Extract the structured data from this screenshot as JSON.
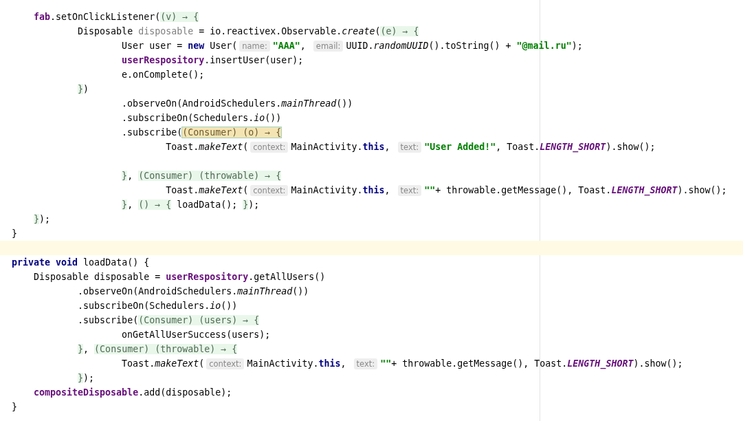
{
  "editor": {
    "lines": [
      {
        "current": false,
        "tokens": [
          {
            "kind": "field",
            "text": "    fab"
          },
          {
            "kind": "plain",
            "text": ".setOnClickListener("
          },
          {
            "kind": "lambda",
            "text": "(v) → {"
          }
        ]
      },
      {
        "current": false,
        "tokens": [
          {
            "kind": "plain",
            "text": "            Disposable "
          },
          {
            "kind": "unused",
            "text": "disposable"
          },
          {
            "kind": "plain",
            "text": " = io.reactivex.Observable."
          },
          {
            "kind": "italic",
            "text": "create"
          },
          {
            "kind": "plain",
            "text": "("
          },
          {
            "kind": "lambda",
            "text": "(e) → {"
          }
        ]
      },
      {
        "current": false,
        "tokens": [
          {
            "kind": "plain",
            "text": "                    User user = "
          },
          {
            "kind": "keyword",
            "text": "new"
          },
          {
            "kind": "plain",
            "text": " User("
          },
          {
            "kind": "hint",
            "text": "name:"
          },
          {
            "kind": "string",
            "text": "\"AAA\""
          },
          {
            "kind": "plain",
            "text": ", "
          },
          {
            "kind": "hint",
            "text": "email:"
          },
          {
            "kind": "plain",
            "text": "UUID."
          },
          {
            "kind": "italic",
            "text": "randomUUID"
          },
          {
            "kind": "plain",
            "text": "().toString() + "
          },
          {
            "kind": "string",
            "text": "\"@mail.ru\""
          },
          {
            "kind": "plain",
            "text": ");"
          }
        ]
      },
      {
        "current": false,
        "tokens": [
          {
            "kind": "field",
            "text": "                    userRespository"
          },
          {
            "kind": "plain",
            "text": ".insertUser(user);"
          }
        ]
      },
      {
        "current": false,
        "tokens": [
          {
            "kind": "plain",
            "text": "                    e.onComplete();"
          }
        ]
      },
      {
        "current": false,
        "tokens": [
          {
            "kind": "lambda",
            "text": "            }"
          },
          {
            "kind": "plain",
            "text": ")"
          }
        ]
      },
      {
        "current": false,
        "tokens": [
          {
            "kind": "plain",
            "text": "                    .observeOn(AndroidSchedulers."
          },
          {
            "kind": "italic",
            "text": "mainThread"
          },
          {
            "kind": "plain",
            "text": "())"
          }
        ]
      },
      {
        "current": false,
        "tokens": [
          {
            "kind": "plain",
            "text": "                    .subscribeOn(Schedulers."
          },
          {
            "kind": "italic",
            "text": "io"
          },
          {
            "kind": "plain",
            "text": "())"
          }
        ]
      },
      {
        "current": false,
        "tokens": [
          {
            "kind": "plain",
            "text": "                    .subscribe("
          },
          {
            "kind": "lambda_active",
            "text": "(Consumer) (o) → {"
          }
        ]
      },
      {
        "current": false,
        "tokens": [
          {
            "kind": "plain",
            "text": "                            Toast."
          },
          {
            "kind": "italic",
            "text": "makeText"
          },
          {
            "kind": "plain",
            "text": "("
          },
          {
            "kind": "hint",
            "text": "context:"
          },
          {
            "kind": "plain",
            "text": "MainActivity."
          },
          {
            "kind": "keyword",
            "text": "this"
          },
          {
            "kind": "plain",
            "text": ", "
          },
          {
            "kind": "hint",
            "text": "text:"
          },
          {
            "kind": "string",
            "text": "\"User Added!\""
          },
          {
            "kind": "plain",
            "text": ", Toast."
          },
          {
            "kind": "constant",
            "text": "LENGTH_SHORT"
          },
          {
            "kind": "plain",
            "text": ").show();"
          }
        ]
      },
      {
        "current": false
      },
      {
        "current": false,
        "tokens": [
          {
            "kind": "lambda",
            "text": "                    }"
          },
          {
            "kind": "plain",
            "text": ", "
          },
          {
            "kind": "lambda",
            "text": "(Consumer) (throwable) → {"
          }
        ]
      },
      {
        "current": false,
        "tokens": [
          {
            "kind": "plain",
            "text": "                            Toast."
          },
          {
            "kind": "italic",
            "text": "makeText"
          },
          {
            "kind": "plain",
            "text": "("
          },
          {
            "kind": "hint",
            "text": "context:"
          },
          {
            "kind": "plain",
            "text": "MainActivity."
          },
          {
            "kind": "keyword",
            "text": "this"
          },
          {
            "kind": "plain",
            "text": ", "
          },
          {
            "kind": "hint",
            "text": "text:"
          },
          {
            "kind": "string",
            "text": "\"\""
          },
          {
            "kind": "plain",
            "text": "+ throwable.getMessage(), Toast."
          },
          {
            "kind": "constant",
            "text": "LENGTH_SHORT"
          },
          {
            "kind": "plain",
            "text": ").show();"
          }
        ]
      },
      {
        "current": false,
        "tokens": [
          {
            "kind": "lambda",
            "text": "                    }"
          },
          {
            "kind": "plain",
            "text": ", "
          },
          {
            "kind": "lambda",
            "text": "() → {"
          },
          {
            "kind": "plain",
            "text": " loadData(); "
          },
          {
            "kind": "lambda",
            "text": "}"
          },
          {
            "kind": "plain",
            "text": ");"
          }
        ]
      },
      {
        "current": false,
        "tokens": [
          {
            "kind": "lambda",
            "text": "    }"
          },
          {
            "kind": "plain",
            "text": ");"
          }
        ]
      },
      {
        "current": false,
        "tokens": [
          {
            "kind": "plain",
            "text": "}"
          }
        ]
      },
      {
        "current": true
      },
      {
        "current": false,
        "tokens": [
          {
            "kind": "keyword",
            "text": "private"
          },
          {
            "kind": "keyword",
            "text": " void"
          },
          {
            "kind": "plain",
            "text": " loadData() {"
          }
        ]
      },
      {
        "current": false,
        "tokens": [
          {
            "kind": "plain",
            "text": "    Disposable disposable = "
          },
          {
            "kind": "field",
            "text": "userRespository"
          },
          {
            "kind": "plain",
            "text": ".getAllUsers()"
          }
        ]
      },
      {
        "current": false,
        "tokens": [
          {
            "kind": "plain",
            "text": "            .observeOn(AndroidSchedulers."
          },
          {
            "kind": "italic",
            "text": "mainThread"
          },
          {
            "kind": "plain",
            "text": "())"
          }
        ]
      },
      {
        "current": false,
        "tokens": [
          {
            "kind": "plain",
            "text": "            .subscribeOn(Schedulers."
          },
          {
            "kind": "italic",
            "text": "io"
          },
          {
            "kind": "plain",
            "text": "())"
          }
        ]
      },
      {
        "current": false,
        "tokens": [
          {
            "kind": "plain",
            "text": "            .subscribe("
          },
          {
            "kind": "lambda",
            "text": "(Consumer) (users) → {"
          }
        ]
      },
      {
        "current": false,
        "tokens": [
          {
            "kind": "plain",
            "text": "                    onGetAllUserSuccess(users);"
          }
        ]
      },
      {
        "current": false,
        "tokens": [
          {
            "kind": "lambda",
            "text": "            }"
          },
          {
            "kind": "plain",
            "text": ", "
          },
          {
            "kind": "lambda",
            "text": "(Consumer) (throwable) → {"
          }
        ]
      },
      {
        "current": false,
        "tokens": [
          {
            "kind": "plain",
            "text": "                    Toast."
          },
          {
            "kind": "italic",
            "text": "makeText"
          },
          {
            "kind": "plain",
            "text": "("
          },
          {
            "kind": "hint",
            "text": "context:"
          },
          {
            "kind": "plain",
            "text": "MainActivity."
          },
          {
            "kind": "keyword",
            "text": "this"
          },
          {
            "kind": "plain",
            "text": ", "
          },
          {
            "kind": "hint",
            "text": "text:"
          },
          {
            "kind": "string",
            "text": "\"\""
          },
          {
            "kind": "plain",
            "text": "+ throwable.getMessage(), Toast."
          },
          {
            "kind": "constant",
            "text": "LENGTH_SHORT"
          },
          {
            "kind": "plain",
            "text": ").show();"
          }
        ]
      },
      {
        "current": false,
        "tokens": [
          {
            "kind": "lambda",
            "text": "            }"
          },
          {
            "kind": "plain",
            "text": ");"
          }
        ]
      },
      {
        "current": false,
        "tokens": [
          {
            "kind": "field",
            "text": "    compositeDisposable"
          },
          {
            "kind": "plain",
            "text": ".add(disposable);"
          }
        ]
      },
      {
        "current": false,
        "tokens": [
          {
            "kind": "plain",
            "text": "}"
          }
        ]
      }
    ]
  }
}
